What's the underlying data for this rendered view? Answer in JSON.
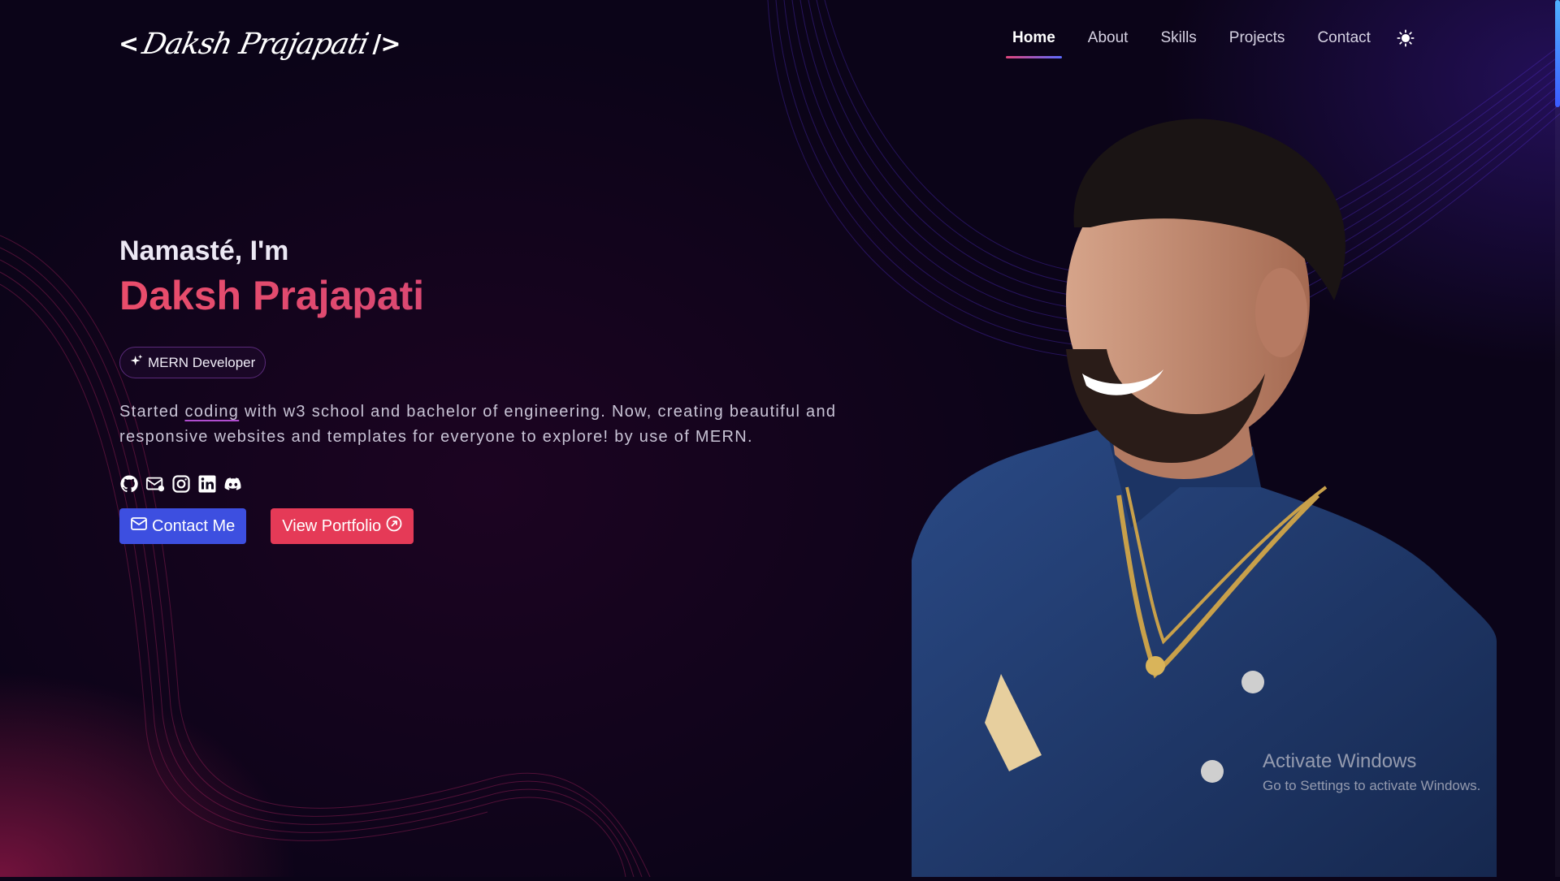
{
  "logo": {
    "open": "<",
    "text": "Daksh Prajapati",
    "close": "/>"
  },
  "nav": {
    "items": [
      {
        "label": "Home",
        "active": true
      },
      {
        "label": "About"
      },
      {
        "label": "Skills"
      },
      {
        "label": "Projects"
      },
      {
        "label": "Contact"
      }
    ],
    "theme_toggle_icon": "sun-icon"
  },
  "hero": {
    "greeting": "Namasté, I'm",
    "name": "Daksh Prajapati",
    "badge": {
      "icon": "sparkle-icon",
      "label": "MERN Developer"
    },
    "description": {
      "before": "Started ",
      "highlight": "coding",
      "after": " with w3 school and bachelor of engineering. Now, creating beautiful and responsive websites and templates for everyone to explore! by use of MERN."
    },
    "socials": [
      "github-icon",
      "mail-icon",
      "instagram-icon",
      "linkedin-icon",
      "discord-icon"
    ],
    "buttons": {
      "contact": {
        "label": "Contact Me",
        "icon": "envelope-icon"
      },
      "portfolio": {
        "label": "View Portfolio",
        "icon": "arrow-up-right-circle-icon"
      }
    }
  },
  "watermark": {
    "title": "Activate Windows",
    "subtitle": "Go to Settings to activate Windows."
  },
  "colors": {
    "background": "#0b0418",
    "accent_name": "#e0457b",
    "primary_button": "#3d4fe0",
    "secondary_button": "#e53a57",
    "jacket": "#1e3566"
  }
}
